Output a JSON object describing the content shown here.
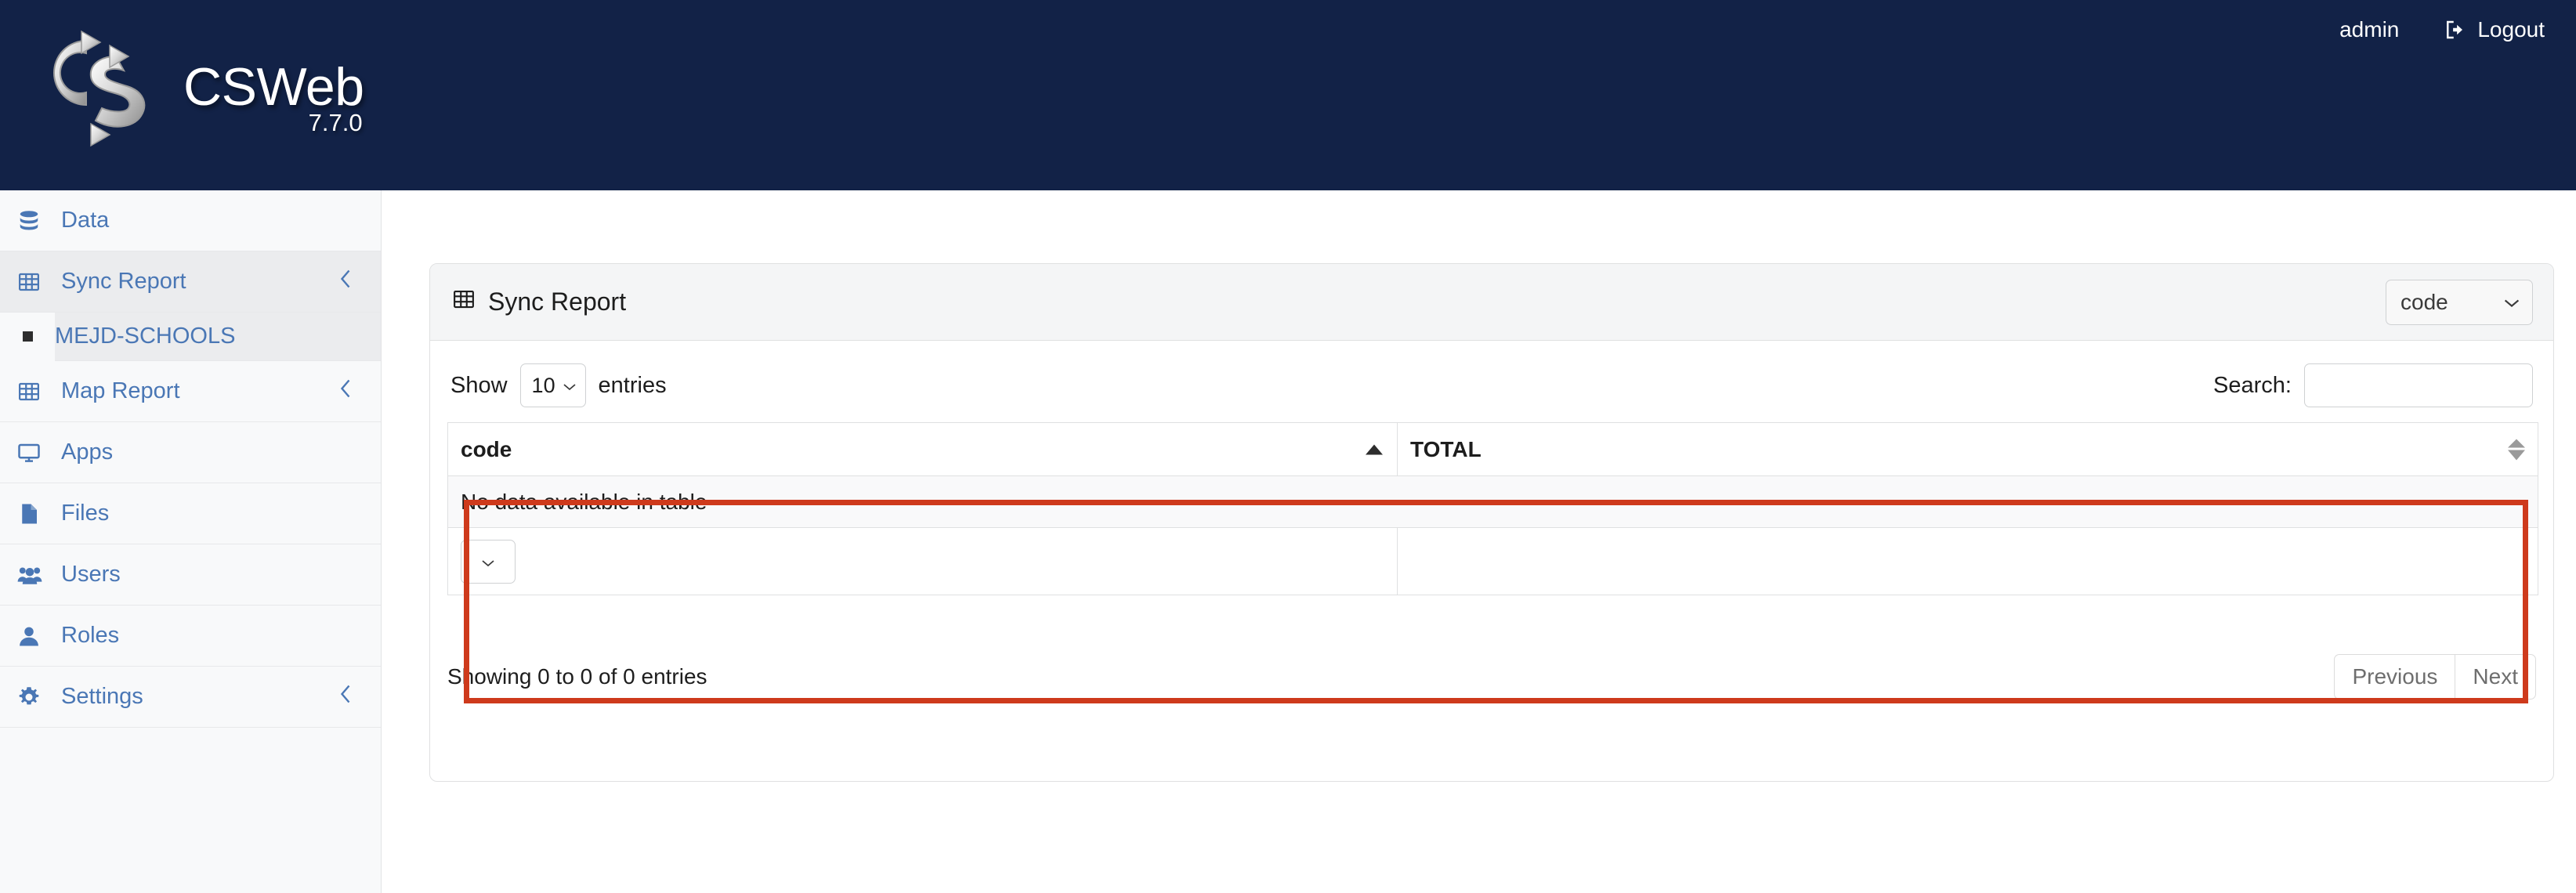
{
  "header": {
    "brand_name": "CSWeb",
    "version": "7.7.0",
    "logo_icon": "csweb-logo-icon",
    "username": "admin",
    "logout_label": "Logout",
    "logout_icon": "sign-out-icon",
    "background_color": "#122247"
  },
  "sidebar": {
    "items": [
      {
        "label": "Data",
        "icon": "database-icon",
        "active": false,
        "expandable": false
      },
      {
        "label": "Sync Report",
        "icon": "table-icon",
        "active": true,
        "expandable": true
      },
      {
        "label": "Map Report",
        "icon": "table-icon",
        "active": false,
        "expandable": true
      },
      {
        "label": "Apps",
        "icon": "desktop-icon",
        "active": false,
        "expandable": false
      },
      {
        "label": "Files",
        "icon": "file-icon",
        "active": false,
        "expandable": false
      },
      {
        "label": "Users",
        "icon": "users-icon",
        "active": false,
        "expandable": false
      },
      {
        "label": "Roles",
        "icon": "user-icon",
        "active": false,
        "expandable": false
      },
      {
        "label": "Settings",
        "icon": "gear-icon",
        "active": false,
        "expandable": true
      }
    ],
    "subitem": {
      "label": "MEJD-SCHOOLS",
      "bullet_icon": "square-bullet-icon"
    },
    "link_color": "#4a77b5"
  },
  "card": {
    "title": "Sync Report",
    "title_icon": "table-icon",
    "field_select": {
      "value": "code",
      "icon": "chevron-down-icon"
    }
  },
  "datatable": {
    "length_label_before": "Show",
    "length_value": "10",
    "length_label_after": "entries",
    "search_label": "Search:",
    "search_value": "",
    "search_placeholder": "",
    "columns": [
      {
        "label": "code",
        "sort": "asc"
      },
      {
        "label": "TOTAL",
        "sort": "none"
      }
    ],
    "empty_message": "No data available in table",
    "footer_select_value": "",
    "info": "Showing 0 to 0 of 0 entries",
    "paging": {
      "previous": "Previous",
      "next": "Next"
    }
  },
  "annotation": {
    "highlight_color": "#ce3a1c",
    "target": "datatable-region"
  }
}
